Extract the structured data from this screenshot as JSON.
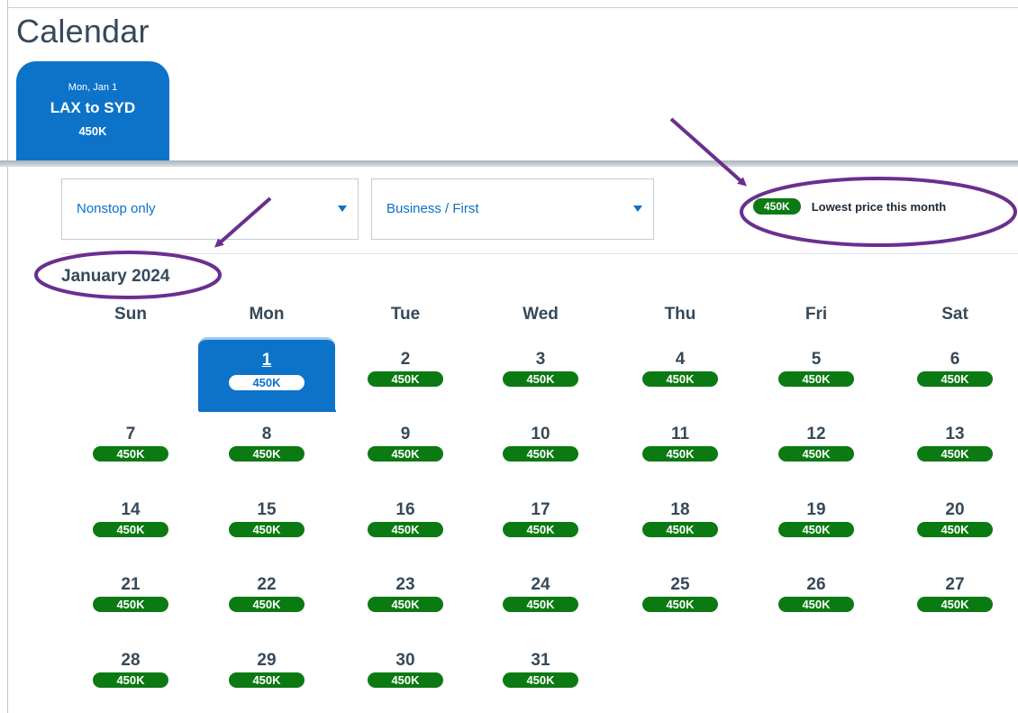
{
  "page": {
    "title": "Calendar",
    "accent_color": "#0d73c9",
    "price_color": "#0b7a12",
    "annotation_color": "#6a2f8e"
  },
  "flight_tab": {
    "date": "Mon, Jan 1",
    "route": "LAX to SYD",
    "price": "450K"
  },
  "filters": {
    "stops": {
      "value": "Nonstop only",
      "icon": "chevron-down-icon"
    },
    "cabin": {
      "value": "Business / First",
      "icon": "chevron-down-icon"
    }
  },
  "legend": {
    "price": "450K",
    "text": "Lowest price this month"
  },
  "calendar": {
    "month": "January 2024",
    "weekdays": [
      "Sun",
      "Mon",
      "Tue",
      "Wed",
      "Thu",
      "Fri",
      "Sat"
    ],
    "selected_day": 1,
    "days": [
      {
        "day": "1",
        "price": "450K"
      },
      {
        "day": "2",
        "price": "450K"
      },
      {
        "day": "3",
        "price": "450K"
      },
      {
        "day": "4",
        "price": "450K"
      },
      {
        "day": "5",
        "price": "450K"
      },
      {
        "day": "6",
        "price": "450K"
      },
      {
        "day": "7",
        "price": "450K"
      },
      {
        "day": "8",
        "price": "450K"
      },
      {
        "day": "9",
        "price": "450K"
      },
      {
        "day": "10",
        "price": "450K"
      },
      {
        "day": "11",
        "price": "450K"
      },
      {
        "day": "12",
        "price": "450K"
      },
      {
        "day": "13",
        "price": "450K"
      },
      {
        "day": "14",
        "price": "450K"
      },
      {
        "day": "15",
        "price": "450K"
      },
      {
        "day": "16",
        "price": "450K"
      },
      {
        "day": "17",
        "price": "450K"
      },
      {
        "day": "18",
        "price": "450K"
      },
      {
        "day": "19",
        "price": "450K"
      },
      {
        "day": "20",
        "price": "450K"
      },
      {
        "day": "21",
        "price": "450K"
      },
      {
        "day": "22",
        "price": "450K"
      },
      {
        "day": "23",
        "price": "450K"
      },
      {
        "day": "24",
        "price": "450K"
      },
      {
        "day": "25",
        "price": "450K"
      },
      {
        "day": "26",
        "price": "450K"
      },
      {
        "day": "27",
        "price": "450K"
      },
      {
        "day": "28",
        "price": "450K"
      },
      {
        "day": "29",
        "price": "450K"
      },
      {
        "day": "30",
        "price": "450K"
      },
      {
        "day": "31",
        "price": "450K"
      }
    ]
  }
}
